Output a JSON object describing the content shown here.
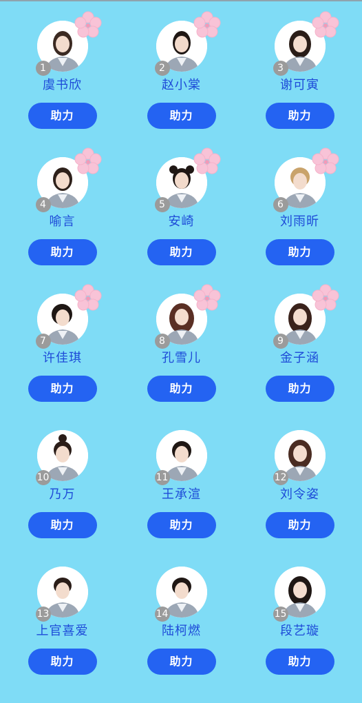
{
  "colors": {
    "background": "#7fdcf6",
    "button": "#2463f2",
    "name_text": "#1e4bd8",
    "rank_badge": "#9b9b9b",
    "flower": "#f8c3d7"
  },
  "contestants": [
    {
      "rank": "1",
      "name": "虞书欣",
      "button": "助力",
      "flower": true
    },
    {
      "rank": "2",
      "name": "赵小棠",
      "button": "助力",
      "flower": true
    },
    {
      "rank": "3",
      "name": "谢可寅",
      "button": "助力",
      "flower": true
    },
    {
      "rank": "4",
      "name": "喻言",
      "button": "助力",
      "flower": true
    },
    {
      "rank": "5",
      "name": "安崎",
      "button": "助力",
      "flower": true
    },
    {
      "rank": "6",
      "name": "刘雨昕",
      "button": "助力",
      "flower": true
    },
    {
      "rank": "7",
      "name": "许佳琪",
      "button": "助力",
      "flower": true
    },
    {
      "rank": "8",
      "name": "孔雪儿",
      "button": "助力",
      "flower": true
    },
    {
      "rank": "9",
      "name": "金子涵",
      "button": "助力",
      "flower": true
    },
    {
      "rank": "10",
      "name": "乃万",
      "button": "助力",
      "flower": false
    },
    {
      "rank": "11",
      "name": "王承渲",
      "button": "助力",
      "flower": false
    },
    {
      "rank": "12",
      "name": "刘令姿",
      "button": "助力",
      "flower": false
    },
    {
      "rank": "13",
      "name": "上官喜爱",
      "button": "助力",
      "flower": false
    },
    {
      "rank": "14",
      "name": "陆柯燃",
      "button": "助力",
      "flower": false
    },
    {
      "rank": "15",
      "name": "段艺璇",
      "button": "助力",
      "flower": false
    }
  ]
}
